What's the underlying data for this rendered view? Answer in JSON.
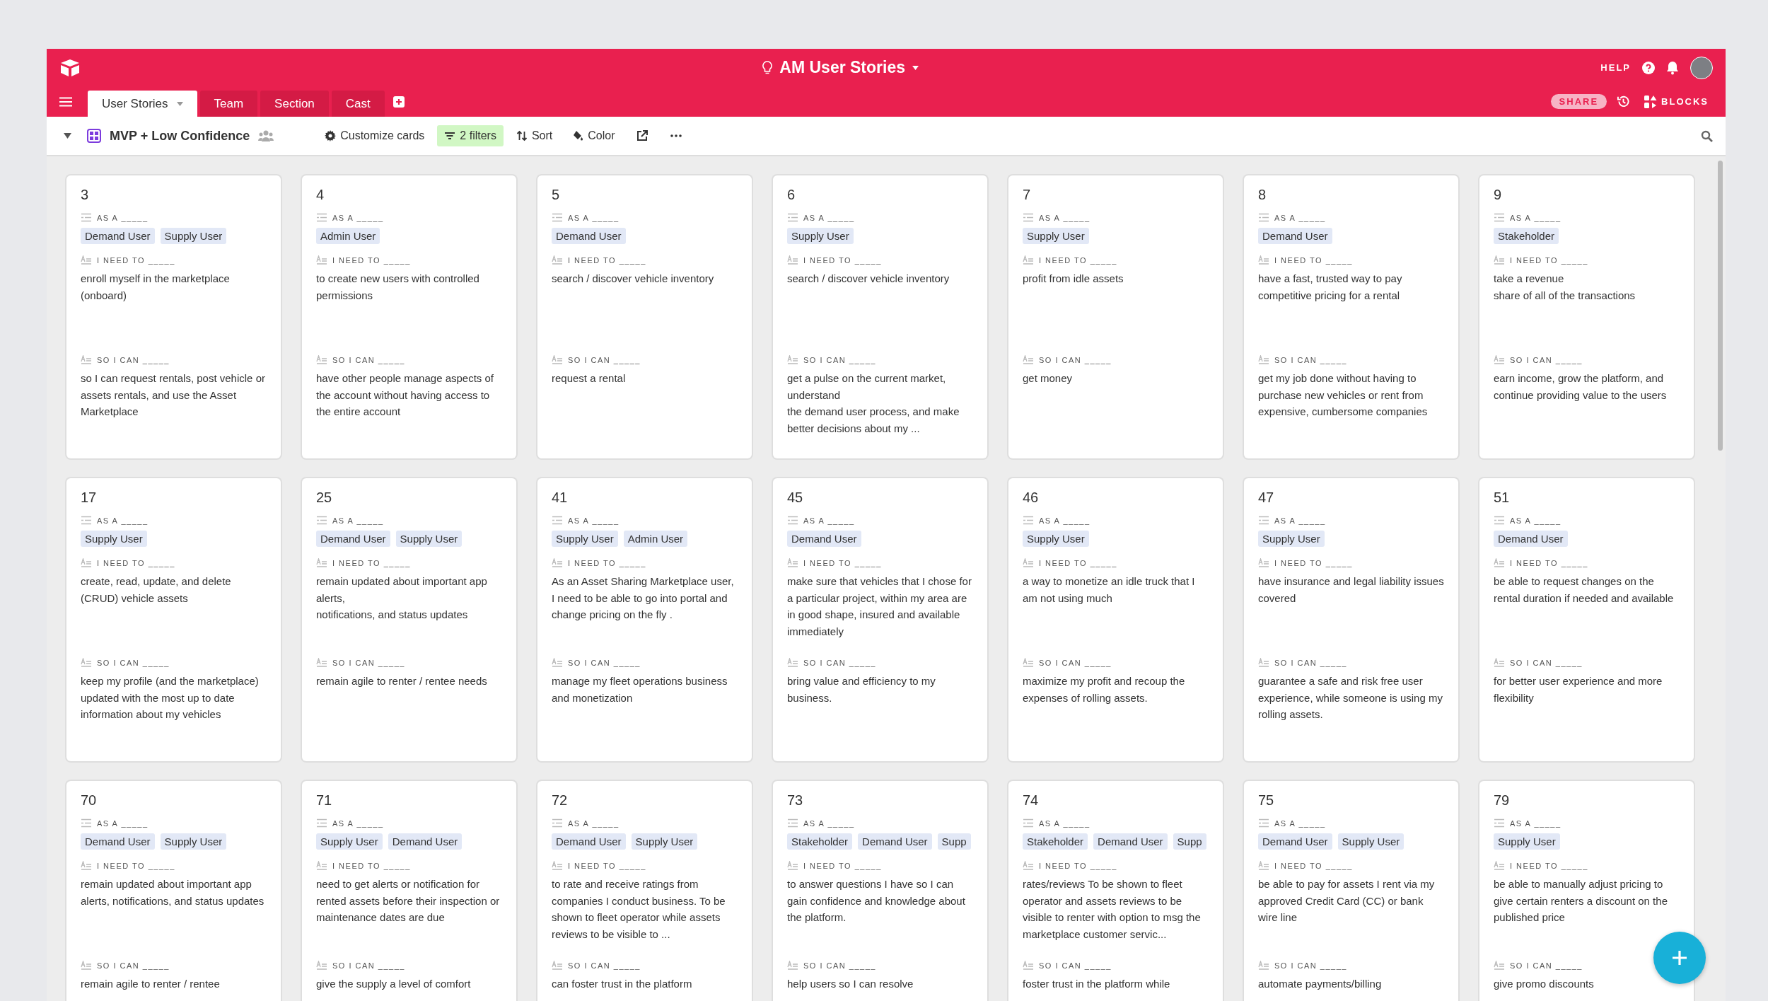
{
  "app": {
    "title": "AM User Stories",
    "help": "HELP",
    "share": "SHARE",
    "blocks": "BLOCKS"
  },
  "tabs": [
    {
      "label": "User Stories",
      "selected": true
    },
    {
      "label": "Team",
      "selected": false
    },
    {
      "label": "Section",
      "selected": false
    },
    {
      "label": "Cast",
      "selected": false
    }
  ],
  "view": {
    "name": "MVP + Low Confidence"
  },
  "tools": [
    {
      "label": "Customize cards",
      "kind": "customize",
      "active": false
    },
    {
      "label": "2 filters",
      "kind": "filter",
      "active": true
    },
    {
      "label": "Sort",
      "kind": "sort",
      "active": false
    },
    {
      "label": "Color",
      "kind": "color",
      "active": false
    }
  ],
  "cards": [
    {
      "number": "3",
      "fields": [
        {
          "label": "AS A _____",
          "kind": "tags",
          "tags": [
            "Demand User",
            "Supply User"
          ]
        },
        {
          "label": "I NEED TO _____",
          "kind": "text",
          "text": "enroll myself in the marketplace (onboard)"
        },
        {
          "label": "SO I CAN _____",
          "kind": "text",
          "text": "so I can request rentals, post vehicle or assets rentals, and use the Asset Marketplace"
        }
      ]
    },
    {
      "number": "4",
      "fields": [
        {
          "label": "AS A _____",
          "kind": "tags",
          "tags": [
            "Admin User"
          ]
        },
        {
          "label": "I NEED TO _____",
          "kind": "text",
          "text": "to create new users with controlled permissions"
        },
        {
          "label": "SO I CAN _____",
          "kind": "text",
          "text": "have other people manage aspects of the account without having access to the entire account"
        }
      ]
    },
    {
      "number": "5",
      "fields": [
        {
          "label": "AS A _____",
          "kind": "tags",
          "tags": [
            "Demand User"
          ]
        },
        {
          "label": "I NEED TO _____",
          "kind": "text",
          "text": "search / discover vehicle inventory"
        },
        {
          "label": "SO I CAN _____",
          "kind": "text",
          "text": "request a rental"
        }
      ]
    },
    {
      "number": "6",
      "fields": [
        {
          "label": "AS A _____",
          "kind": "tags",
          "tags": [
            "Supply User"
          ]
        },
        {
          "label": "I NEED TO _____",
          "kind": "text",
          "text": "search / discover vehicle inventory"
        },
        {
          "label": "SO I CAN _____",
          "kind": "text",
          "text": "get a pulse on the current market, understand\nthe demand user process, and make better decisions about my ..."
        }
      ]
    },
    {
      "number": "7",
      "fields": [
        {
          "label": "AS A _____",
          "kind": "tags",
          "tags": [
            "Supply User"
          ]
        },
        {
          "label": "I NEED TO _____",
          "kind": "text",
          "text": "profit from idle assets"
        },
        {
          "label": "SO I CAN _____",
          "kind": "text",
          "text": "get money"
        }
      ]
    },
    {
      "number": "8",
      "fields": [
        {
          "label": "AS A _____",
          "kind": "tags",
          "tags": [
            "Demand User"
          ]
        },
        {
          "label": "I NEED TO _____",
          "kind": "text",
          "text": "have a fast, trusted way to pay competitive pricing for a rental"
        },
        {
          "label": "SO I CAN _____",
          "kind": "text",
          "text": "get my job done without having to purchase new vehicles or rent from expensive, cumbersome companies"
        }
      ]
    },
    {
      "number": "9",
      "fields": [
        {
          "label": "AS A _____",
          "kind": "tags",
          "tags": [
            "Stakeholder"
          ]
        },
        {
          "label": "I NEED TO _____",
          "kind": "text",
          "text": "take a revenue\nshare of all of the transactions"
        },
        {
          "label": "SO I CAN _____",
          "kind": "text",
          "text": "earn income, grow the platform, and continue providing value to the users"
        }
      ]
    },
    {
      "number": "17",
      "fields": [
        {
          "label": "AS A _____",
          "kind": "tags",
          "tags": [
            "Supply User"
          ]
        },
        {
          "label": "I NEED TO _____",
          "kind": "text",
          "text": "create, read, update, and delete (CRUD) vehicle assets"
        },
        {
          "label": "SO I CAN _____",
          "kind": "text",
          "text": "keep my profile (and the marketplace) updated with the most up to date information about my vehicles"
        }
      ]
    },
    {
      "number": "25",
      "fields": [
        {
          "label": "AS A _____",
          "kind": "tags",
          "tags": [
            "Demand User",
            "Supply User"
          ]
        },
        {
          "label": "I NEED TO _____",
          "kind": "text",
          "text": "remain updated about important app alerts,\nnotifications, and status updates"
        },
        {
          "label": "SO I CAN _____",
          "kind": "text",
          "text": "remain agile to renter / rentee needs"
        }
      ]
    },
    {
      "number": "41",
      "fields": [
        {
          "label": "AS A _____",
          "kind": "tags",
          "tags": [
            "Supply User",
            "Admin User"
          ]
        },
        {
          "label": "I NEED TO _____",
          "kind": "text",
          "text": "As an Asset Sharing Marketplace user, I need to be able to go into portal and change pricing on the fly ."
        },
        {
          "label": "SO I CAN _____",
          "kind": "text",
          "text": "manage my fleet operations business and monetization"
        }
      ]
    },
    {
      "number": "45",
      "fields": [
        {
          "label": "AS A _____",
          "kind": "tags",
          "tags": [
            "Demand User"
          ]
        },
        {
          "label": "I NEED TO _____",
          "kind": "text",
          "text": "make sure that vehicles that I chose for a particular project, within my area are in good shape, insured and available immediately"
        },
        {
          "label": "SO I CAN _____",
          "kind": "text",
          "text": "bring value and efficiency to my business."
        }
      ]
    },
    {
      "number": "46",
      "fields": [
        {
          "label": "AS A _____",
          "kind": "tags",
          "tags": [
            "Supply User"
          ]
        },
        {
          "label": "I NEED TO _____",
          "kind": "text",
          "text": "a way to monetize an idle truck that I am not using much"
        },
        {
          "label": "SO I CAN _____",
          "kind": "text",
          "text": "maximize my profit and recoup the expenses of rolling assets."
        }
      ]
    },
    {
      "number": "47",
      "fields": [
        {
          "label": "AS A _____",
          "kind": "tags",
          "tags": [
            "Supply User"
          ]
        },
        {
          "label": "I NEED TO _____",
          "kind": "text",
          "text": "have insurance and legal liability issues covered"
        },
        {
          "label": "SO I CAN _____",
          "kind": "text",
          "text": "guarantee a safe and risk free user experience, while someone is using my rolling assets."
        }
      ]
    },
    {
      "number": "51",
      "fields": [
        {
          "label": "AS A _____",
          "kind": "tags",
          "tags": [
            "Demand User"
          ]
        },
        {
          "label": "I NEED TO _____",
          "kind": "text",
          "text": "be able to request changes on the rental duration if needed and available"
        },
        {
          "label": "SO I CAN _____",
          "kind": "text",
          "text": "for better user experience and more flexibility"
        }
      ]
    },
    {
      "number": "70",
      "fields": [
        {
          "label": "AS A _____",
          "kind": "tags",
          "tags": [
            "Demand User",
            "Supply User"
          ]
        },
        {
          "label": "I NEED TO _____",
          "kind": "text",
          "text": "remain updated about important app alerts, notifications, and status updates"
        },
        {
          "label": "SO I CAN _____",
          "kind": "text",
          "text": "remain agile to renter / rentee"
        }
      ]
    },
    {
      "number": "71",
      "fields": [
        {
          "label": "AS A _____",
          "kind": "tags",
          "tags": [
            "Supply User",
            "Demand User"
          ]
        },
        {
          "label": "I NEED TO _____",
          "kind": "text",
          "text": "need to get alerts or notification for rented assets before their inspection or maintenance dates are due"
        },
        {
          "label": "SO I CAN _____",
          "kind": "text",
          "text": "give the supply a level of comfort"
        }
      ]
    },
    {
      "number": "72",
      "fields": [
        {
          "label": "AS A _____",
          "kind": "tags",
          "tags": [
            "Demand User",
            "Supply User"
          ]
        },
        {
          "label": "I NEED TO _____",
          "kind": "text",
          "text": "to rate and receive ratings from companies I conduct business. To be shown to fleet operator while assets reviews to be visible to ..."
        },
        {
          "label": "SO I CAN _____",
          "kind": "text",
          "text": "can foster trust in the platform"
        }
      ]
    },
    {
      "number": "73",
      "fields": [
        {
          "label": "AS A _____",
          "kind": "tags",
          "tags": [
            "Stakeholder",
            "Demand User",
            "Supp"
          ]
        },
        {
          "label": "I NEED TO _____",
          "kind": "text",
          "text": "to answer questions I have so I can gain confidence and knowledge about the platform."
        },
        {
          "label": "SO I CAN _____",
          "kind": "text",
          "text": "help users so I can resolve"
        }
      ]
    },
    {
      "number": "74",
      "fields": [
        {
          "label": "AS A _____",
          "kind": "tags",
          "tags": [
            "Stakeholder",
            "Demand User",
            "Supp"
          ]
        },
        {
          "label": "I NEED TO _____",
          "kind": "text",
          "text": "rates/reviews To be shown to fleet operator and assets reviews to be visible to renter with option to msg the marketplace customer servic..."
        },
        {
          "label": "SO I CAN _____",
          "kind": "text",
          "text": "foster trust in the platform while"
        }
      ]
    },
    {
      "number": "75",
      "fields": [
        {
          "label": "AS A _____",
          "kind": "tags",
          "tags": [
            "Demand User",
            "Supply User"
          ]
        },
        {
          "label": "I NEED TO _____",
          "kind": "text",
          "text": "be able to pay for assets I rent via my approved Credit Card (CC) or bank wire line"
        },
        {
          "label": "SO I CAN _____",
          "kind": "text",
          "text": "automate payments/billing"
        }
      ]
    },
    {
      "number": "79",
      "fields": [
        {
          "label": "AS A _____",
          "kind": "tags",
          "tags": [
            "Supply User"
          ]
        },
        {
          "label": "I NEED TO _____",
          "kind": "text",
          "text": "be able to manually adjust pricing to give certain renters a discount on the published price"
        },
        {
          "label": "SO I CAN _____",
          "kind": "text",
          "text": "give promo discounts"
        }
      ]
    }
  ]
}
